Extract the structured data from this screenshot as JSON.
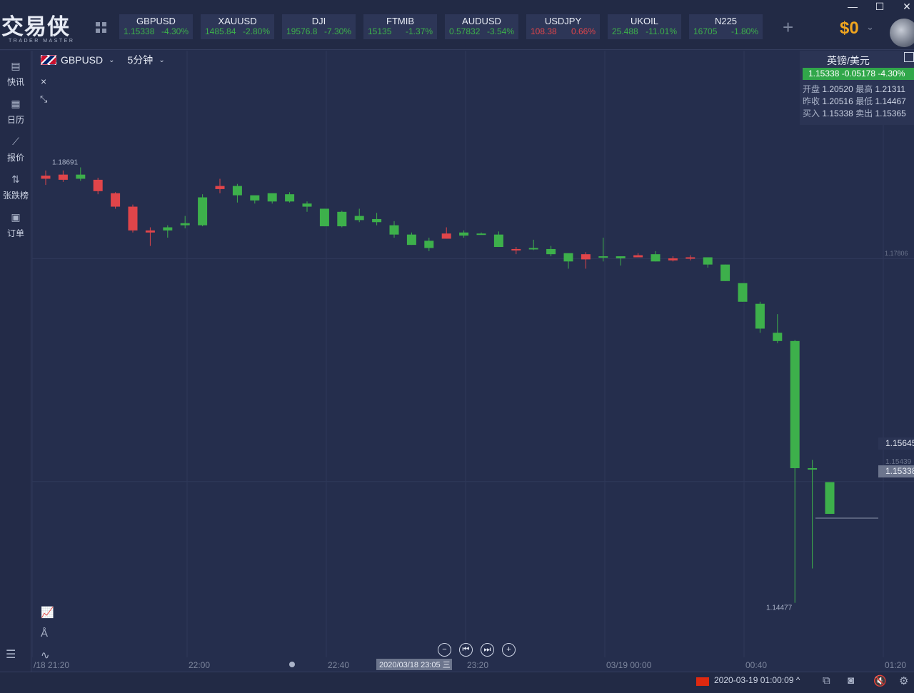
{
  "app": {
    "logo": "交易侠",
    "logo_sub": "TRADER MASTER",
    "window_controls": {
      "minimize": "—",
      "maximize": "☐",
      "close": "✕"
    },
    "add_label": "+",
    "balance": "$0",
    "balance_caret": "⌄"
  },
  "tickers": [
    {
      "symbol": "GBPUSD",
      "price": "1.15338",
      "change": "-4.30%",
      "dir": "up",
      "active": true
    },
    {
      "symbol": "XAUUSD",
      "price": "1485.84",
      "change": "-2.80%",
      "dir": "up"
    },
    {
      "symbol": "DJI",
      "price": "19576.8",
      "change": "-7.30%",
      "dir": "up"
    },
    {
      "symbol": "FTMIB",
      "price": "15135",
      "change": "-1.37%",
      "dir": "up"
    },
    {
      "symbol": "AUDUSD",
      "price": "0.57832",
      "change": "-3.54%",
      "dir": "up"
    },
    {
      "symbol": "USDJPY",
      "price": "108.38",
      "change": "0.66%",
      "dir": "down"
    },
    {
      "symbol": "UKOIL",
      "price": "25.488",
      "change": "-11.01%",
      "dir": "up"
    },
    {
      "symbol": "N225",
      "price": "16705",
      "change": "-1.80%",
      "dir": "up"
    }
  ],
  "sidebar": {
    "items": [
      {
        "label": "快讯",
        "icon": "news-icon"
      },
      {
        "label": "日历",
        "icon": "calendar-icon"
      },
      {
        "label": "报价",
        "icon": "chart-line-icon"
      },
      {
        "label": "张跌榜",
        "icon": "sort-arrows-icon"
      },
      {
        "label": "订单",
        "icon": "order-icon"
      }
    ],
    "menu_icon": "☰"
  },
  "chart_header": {
    "symbol": "GBPUSD",
    "interval": "5分钟",
    "close": "×",
    "shrink": "⤡"
  },
  "info_panel": {
    "title": "英镑/美元",
    "summary": "1.15338 -0.05178 -4.30%",
    "open_label": "开盘",
    "open": "1.20520",
    "high_label": "最高",
    "high": "1.21311",
    "prev_label": "昨收",
    "prev": "1.20516",
    "low_label": "最低",
    "low": "1.14467",
    "bid_label": "买入",
    "bid": "1.15338",
    "ask_label": "卖出",
    "ask": "1.15365"
  },
  "price_tags": {
    "current_high": "1.15645",
    "mid": "1.15439",
    "last": "1.15338",
    "grid_level": "1.17806"
  },
  "bottom": {
    "clock": "2020-03-19 01:00:09",
    "caret": "^",
    "crosshair_time": "2020/03/18 23:05 三"
  },
  "chart_data": {
    "type": "candlestick",
    "interval": "5分钟",
    "y_range": [
      1.1395,
      1.1975
    ],
    "x_axis_labels": [
      "/18 21:20",
      "22:00",
      "22:40",
      "23:20",
      "03/19 00:00",
      "00:40",
      "01:20"
    ],
    "y_axis_labels": [
      "1.17806"
    ],
    "annotations": [
      {
        "label": "1.18691",
        "value": 1.18691
      },
      {
        "label": "1.14477",
        "value": 1.14477
      }
    ],
    "candles": [
      {
        "o": 1.1861,
        "h": 1.1866,
        "l": 1.1852,
        "c": 1.1858
      },
      {
        "o": 1.1862,
        "h": 1.1866,
        "l": 1.1855,
        "c": 1.1857
      },
      {
        "o": 1.1858,
        "h": 1.1869,
        "l": 1.1856,
        "c": 1.1862
      },
      {
        "o": 1.1857,
        "h": 1.1859,
        "l": 1.1843,
        "c": 1.1846
      },
      {
        "o": 1.1844,
        "h": 1.1845,
        "l": 1.1829,
        "c": 1.1831
      },
      {
        "o": 1.1831,
        "h": 1.1833,
        "l": 1.1806,
        "c": 1.1808
      },
      {
        "o": 1.1808,
        "h": 1.1811,
        "l": 1.1793,
        "c": 1.1806
      },
      {
        "o": 1.1808,
        "h": 1.1813,
        "l": 1.1801,
        "c": 1.1811
      },
      {
        "o": 1.1813,
        "h": 1.1822,
        "l": 1.181,
        "c": 1.1815
      },
      {
        "o": 1.1813,
        "h": 1.1843,
        "l": 1.1812,
        "c": 1.184
      },
      {
        "o": 1.1851,
        "h": 1.1858,
        "l": 1.1844,
        "c": 1.1848
      },
      {
        "o": 1.1842,
        "h": 1.1853,
        "l": 1.1835,
        "c": 1.1851
      },
      {
        "o": 1.1837,
        "h": 1.1841,
        "l": 1.1834,
        "c": 1.1842
      },
      {
        "o": 1.1836,
        "h": 1.1843,
        "l": 1.1834,
        "c": 1.1844
      },
      {
        "o": 1.1836,
        "h": 1.1845,
        "l": 1.1835,
        "c": 1.1843
      },
      {
        "o": 1.1831,
        "h": 1.1836,
        "l": 1.1826,
        "c": 1.1834
      },
      {
        "o": 1.1812,
        "h": 1.1829,
        "l": 1.1812,
        "c": 1.1829
      },
      {
        "o": 1.1812,
        "h": 1.1827,
        "l": 1.1811,
        "c": 1.1826
      },
      {
        "o": 1.1818,
        "h": 1.1829,
        "l": 1.1816,
        "c": 1.1822
      },
      {
        "o": 1.1816,
        "h": 1.1825,
        "l": 1.1813,
        "c": 1.1819
      },
      {
        "o": 1.1804,
        "h": 1.1817,
        "l": 1.1801,
        "c": 1.1813
      },
      {
        "o": 1.1794,
        "h": 1.1806,
        "l": 1.1794,
        "c": 1.1804
      },
      {
        "o": 1.1791,
        "h": 1.1801,
        "l": 1.1788,
        "c": 1.1798
      },
      {
        "o": 1.1805,
        "h": 1.1811,
        "l": 1.18,
        "c": 1.18
      },
      {
        "o": 1.1803,
        "h": 1.1808,
        "l": 1.1801,
        "c": 1.1806
      },
      {
        "o": 1.1805,
        "h": 1.1806,
        "l": 1.1804,
        "c": 1.1805
      },
      {
        "o": 1.1792,
        "h": 1.1807,
        "l": 1.1792,
        "c": 1.1804
      },
      {
        "o": 1.179,
        "h": 1.1792,
        "l": 1.1785,
        "c": 1.1789
      },
      {
        "o": 1.179,
        "h": 1.1799,
        "l": 1.1789,
        "c": 1.1791
      },
      {
        "o": 1.1785,
        "h": 1.1793,
        "l": 1.1783,
        "c": 1.179
      },
      {
        "o": 1.1778,
        "h": 1.1783,
        "l": 1.1771,
        "c": 1.1786
      },
      {
        "o": 1.1785,
        "h": 1.1787,
        "l": 1.1771,
        "c": 1.178
      },
      {
        "o": 1.1782,
        "h": 1.1801,
        "l": 1.1778,
        "c": 1.1783
      },
      {
        "o": 1.1781,
        "h": 1.1783,
        "l": 1.1774,
        "c": 1.1783
      },
      {
        "o": 1.1784,
        "h": 1.1786,
        "l": 1.1782,
        "c": 1.1782
      },
      {
        "o": 1.1778,
        "h": 1.1788,
        "l": 1.1778,
        "c": 1.1785
      },
      {
        "o": 1.1781,
        "h": 1.1783,
        "l": 1.1778,
        "c": 1.1779
      },
      {
        "o": 1.1782,
        "h": 1.1784,
        "l": 1.1779,
        "c": 1.1781
      },
      {
        "o": 1.1775,
        "h": 1.1782,
        "l": 1.1772,
        "c": 1.1782
      },
      {
        "o": 1.1759,
        "h": 1.1775,
        "l": 1.1759,
        "c": 1.1775
      },
      {
        "o": 1.1739,
        "h": 1.1757,
        "l": 1.1739,
        "c": 1.1757
      },
      {
        "o": 1.1713,
        "h": 1.1739,
        "l": 1.1709,
        "c": 1.1737
      },
      {
        "o": 1.1701,
        "h": 1.1727,
        "l": 1.1699,
        "c": 1.1709
      },
      {
        "o": 1.1578,
        "h": 1.1702,
        "l": 1.14477,
        "c": 1.1701
      },
      {
        "o": 1.1577,
        "h": 1.1586,
        "l": 1.1481,
        "c": 1.1578
      },
      {
        "o": 1.15338,
        "h": 1.15645,
        "l": 1.15338,
        "c": 1.15645
      }
    ]
  }
}
